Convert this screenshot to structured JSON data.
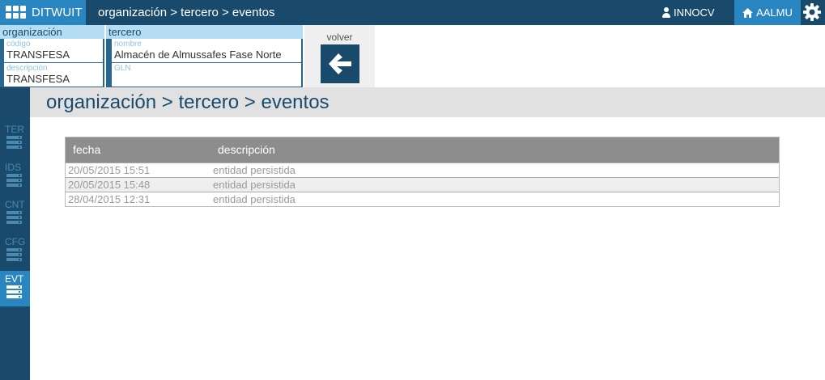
{
  "app": {
    "name": "DITWUIT"
  },
  "header": {
    "breadcrumb": "organización > tercero > eventos",
    "user": "INNOCV",
    "org": "AALMU"
  },
  "org_panel": {
    "title": "organización",
    "fields": [
      {
        "label": "código",
        "value": "TRANSFESA"
      },
      {
        "label": "descripción",
        "value": "TRANSFESA"
      }
    ]
  },
  "tercero_panel": {
    "title": "tercero",
    "fields": [
      {
        "label": "nombre",
        "value": "Almacén de Almussafes Fase Norte"
      },
      {
        "label": "GLN",
        "value": ""
      }
    ]
  },
  "volver": {
    "label": "volver"
  },
  "sidebar": {
    "items": [
      {
        "label": "TER"
      },
      {
        "label": "IDS"
      },
      {
        "label": "CNT"
      },
      {
        "label": "CFG"
      },
      {
        "label": "EVT",
        "active": true
      }
    ]
  },
  "page": {
    "title": "organización > tercero > eventos"
  },
  "table": {
    "columns": [
      "fecha",
      "descripción"
    ],
    "rows": [
      [
        "20/05/2015 15:51",
        "entidad persistida"
      ],
      [
        "20/05/2015 15:48",
        "entidad persistida"
      ],
      [
        "28/04/2015 12:31",
        "entidad persistida"
      ]
    ]
  },
  "colors": {
    "topbar": "#1a4a6b",
    "accent": "#2a86c0",
    "panel_header": "#b4dcf3",
    "table_header": "#8d8d8d"
  }
}
